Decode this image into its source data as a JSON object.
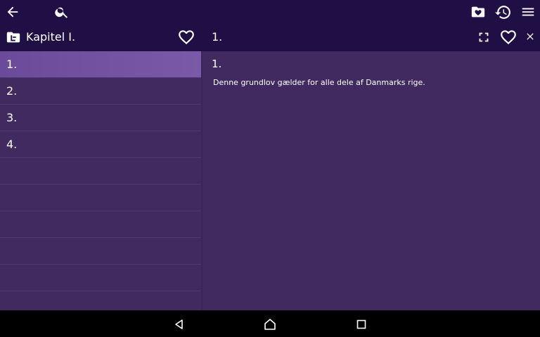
{
  "topbar": {
    "back_icon": "arrow-left-icon",
    "search_icon": "search-icon",
    "favorites_folder_icon": "folder-heart-icon",
    "history_icon": "history-icon",
    "menu_icon": "menu-icon"
  },
  "subbar": {
    "chapter_icon": "folder-tree-icon",
    "chapter_title": "Kapitel I.",
    "chapter_favorite_icon": "heart-outline-icon",
    "detail_title": "1.",
    "fullscreen_icon": "fullscreen-icon",
    "detail_favorite_icon": "heart-outline-icon",
    "close_icon": "close-icon"
  },
  "list": {
    "items": [
      {
        "label": "1.",
        "selected": true
      },
      {
        "label": "2.",
        "selected": false
      },
      {
        "label": "3.",
        "selected": false
      },
      {
        "label": "4.",
        "selected": false
      }
    ]
  },
  "detail": {
    "article_number": "1.",
    "text": "Denne grundlov gælder for alle dele af Danmarks rige."
  },
  "navbar": {
    "back": "back-triangle-icon",
    "home": "home-icon",
    "recents": "recents-square-icon"
  },
  "colors": {
    "bar": "#1f0f45",
    "panel": "#402a5f",
    "selected": "#6b4a9a"
  }
}
